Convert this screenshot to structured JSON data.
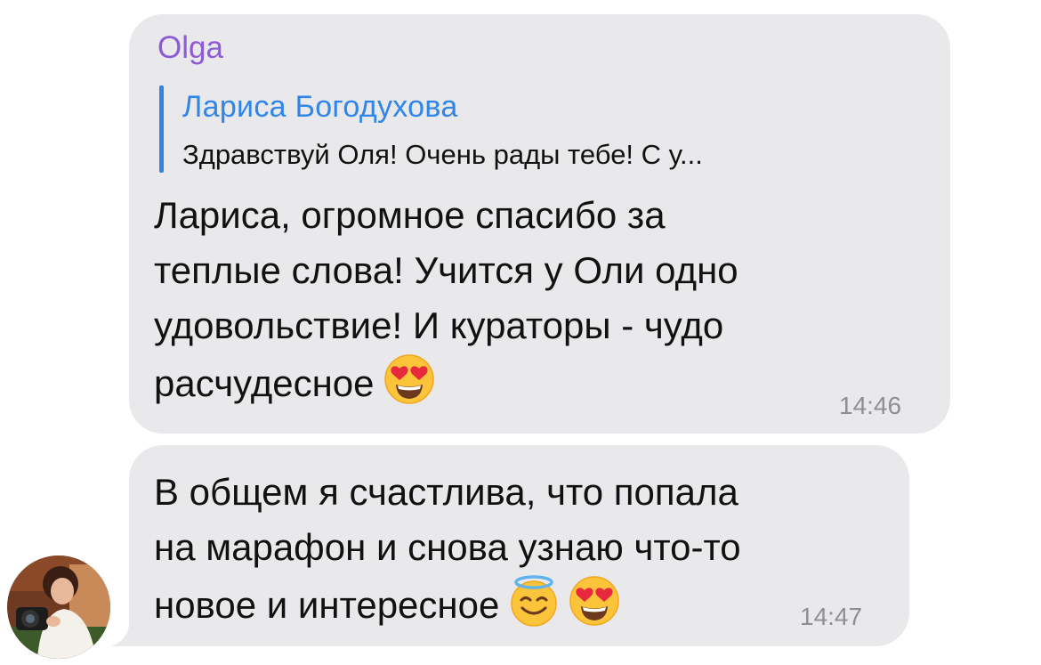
{
  "message1": {
    "sender": "Olga",
    "reply": {
      "author": "Лариса Богодухова",
      "text": "Здравствуй Оля! Очень рады тебе!  С у..."
    },
    "lines": [
      "Лариса, огромное спасибо за",
      "теплые слова! Учится у Оли одно",
      "удовольствие! И кураторы - чудо",
      "расчудесное"
    ],
    "emojis": [
      "heart-eyes-emoji"
    ],
    "time": "14:46"
  },
  "message2": {
    "lines": [
      "В общем я счастлива, что попала",
      "на марафон и снова узнаю что-то",
      "новое и интересное"
    ],
    "emojis": [
      "halo-smile-emoji",
      "heart-eyes-emoji"
    ],
    "time": "14:47"
  },
  "colors": {
    "bubble": "#e9e9eb",
    "sender": "#8e5bd6",
    "reply_accent": "#2f86e8",
    "time": "#8e8e93"
  }
}
